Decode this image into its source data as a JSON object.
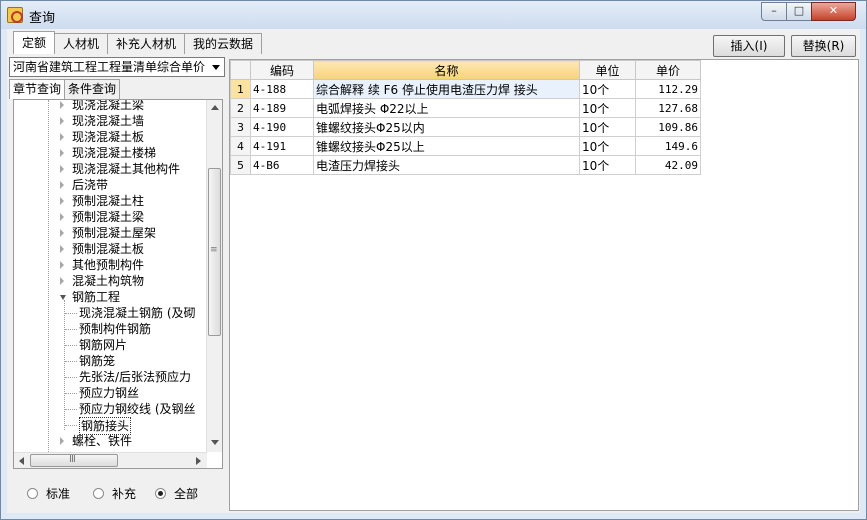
{
  "window": {
    "title": "查询",
    "min_glyph": "–",
    "max_glyph": "□",
    "close_glyph": "✕"
  },
  "tabs": [
    "定额",
    "人材机",
    "补充人材机",
    "我的云数据"
  ],
  "toolbar": {
    "insert_label": "插入(I)",
    "replace_label": "替换(R)"
  },
  "library": {
    "selected": "河南省建筑工程工程量清单综合单价"
  },
  "query_tabs": [
    "章节查询",
    "条件查询"
  ],
  "tree": {
    "items": [
      {
        "label": "现浇混凝土梁",
        "level": 1,
        "state": "collapsed"
      },
      {
        "label": "现浇混凝土墙",
        "level": 1,
        "state": "collapsed"
      },
      {
        "label": "现浇混凝土板",
        "level": 1,
        "state": "collapsed"
      },
      {
        "label": "现浇混凝土楼梯",
        "level": 1,
        "state": "collapsed"
      },
      {
        "label": "现浇混凝土其他构件",
        "level": 1,
        "state": "collapsed"
      },
      {
        "label": "后浇带",
        "level": 1,
        "state": "collapsed"
      },
      {
        "label": "预制混凝土柱",
        "level": 1,
        "state": "collapsed"
      },
      {
        "label": "预制混凝土梁",
        "level": 1,
        "state": "collapsed"
      },
      {
        "label": "预制混凝土屋架",
        "level": 1,
        "state": "collapsed"
      },
      {
        "label": "预制混凝土板",
        "level": 1,
        "state": "collapsed"
      },
      {
        "label": "其他预制构件",
        "level": 1,
        "state": "collapsed"
      },
      {
        "label": "混凝土构筑物",
        "level": 1,
        "state": "collapsed"
      },
      {
        "label": "钢筋工程",
        "level": 1,
        "state": "expanded"
      },
      {
        "label": "现浇混凝土钢筋 (及砌",
        "level": 2,
        "state": "leaf"
      },
      {
        "label": "预制构件钢筋",
        "level": 2,
        "state": "leaf"
      },
      {
        "label": "钢筋网片",
        "level": 2,
        "state": "leaf"
      },
      {
        "label": "钢筋笼",
        "level": 2,
        "state": "leaf"
      },
      {
        "label": "先张法/后张法预应力",
        "level": 2,
        "state": "leaf"
      },
      {
        "label": "预应力钢丝",
        "level": 2,
        "state": "leaf"
      },
      {
        "label": "预应力钢绞线 (及钢丝",
        "level": 2,
        "state": "leaf"
      },
      {
        "label": "钢筋接头",
        "level": 2,
        "state": "selected"
      },
      {
        "label": "螺栓、铁件",
        "level": 1,
        "state": "collapsed"
      }
    ]
  },
  "scroll": {
    "h_grip": "Ⅲ",
    "v_grip": "≡"
  },
  "filter": {
    "options": [
      "标准",
      "补充",
      "全部"
    ],
    "selected": "全部"
  },
  "grid": {
    "columns": [
      "编码",
      "名称",
      "单位",
      "单价"
    ],
    "rows": [
      {
        "no": "1",
        "code": "4-188",
        "name": "综合解释 续 F6 停止使用电渣压力焊 接头",
        "unit": "10个",
        "price": "112.29"
      },
      {
        "no": "2",
        "code": "4-189",
        "name": "电弧焊接头 Φ22以上",
        "unit": "10个",
        "price": "127.68"
      },
      {
        "no": "3",
        "code": "4-190",
        "name": "锥螺纹接头Φ25以内",
        "unit": "10个",
        "price": "109.86"
      },
      {
        "no": "4",
        "code": "4-191",
        "name": "锥螺纹接头Φ25以上",
        "unit": "10个",
        "price": "149.6"
      },
      {
        "no": "5",
        "code": "4-B6",
        "name": "电渣压力焊接头",
        "unit": "10个",
        "price": "42.09"
      }
    ]
  }
}
